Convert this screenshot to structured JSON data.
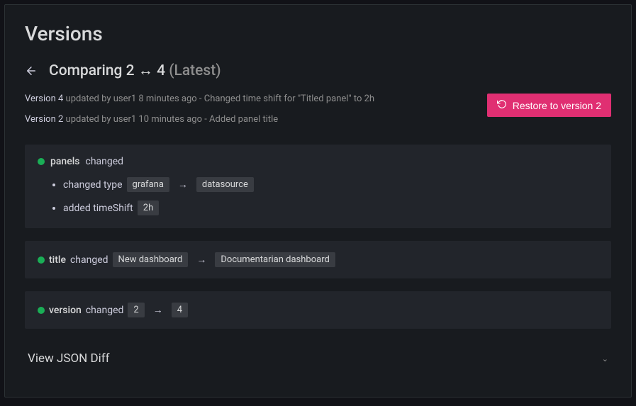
{
  "pageTitle": "Versions",
  "compare": {
    "prefix": "Comparing",
    "from": "2",
    "sep": "↔",
    "to": "4",
    "latest": "(Latest)"
  },
  "metaA": {
    "bold": "Version 4",
    "rest": " updated by user1 8 minutes ago - Changed time shift for \"Titled panel\" to 2h"
  },
  "metaB": {
    "bold": "Version 2",
    "rest": " updated by user1 10 minutes ago - Added panel title"
  },
  "restoreLabel": "Restore to version 2",
  "diffs": {
    "panels": {
      "field": "panels",
      "action": "changed",
      "items": [
        {
          "prefix": "changed type",
          "from": "grafana",
          "to": "datasource"
        },
        {
          "prefix": "added timeShift",
          "single": "2h"
        }
      ]
    },
    "title": {
      "field": "title",
      "action": "changed",
      "from": "New dashboard",
      "to": "Documentarian dashboard"
    },
    "version": {
      "field": "version",
      "action": "changed",
      "from": "2",
      "to": "4"
    }
  },
  "jsonDiffLabel": "View JSON Diff"
}
